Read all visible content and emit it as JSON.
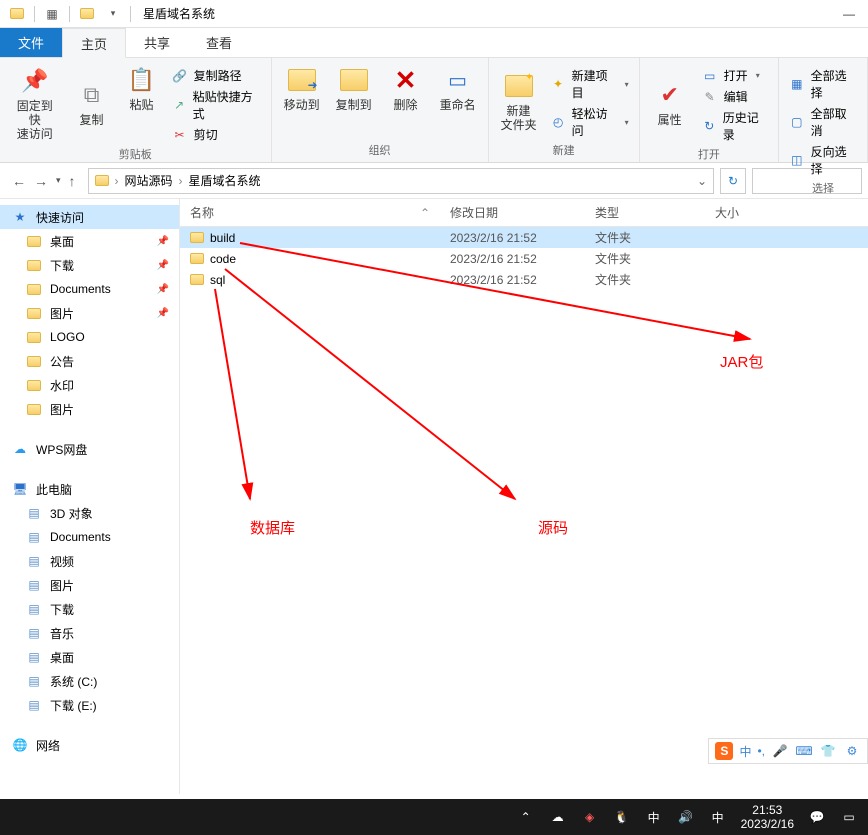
{
  "window": {
    "title": "星盾域名系统"
  },
  "tabs": {
    "file": "文件",
    "home": "主页",
    "share": "共享",
    "view": "查看"
  },
  "ribbon": {
    "clipboard": {
      "pin": "固定到快\n速访问",
      "copy": "复制",
      "paste": "粘贴",
      "copy_path": "复制路径",
      "paste_shortcut": "粘贴快捷方式",
      "cut": "剪切",
      "label": "剪贴板"
    },
    "organize": {
      "moveto": "移动到",
      "copyto": "复制到",
      "delete": "删除",
      "rename": "重命名",
      "label": "组织"
    },
    "new": {
      "newfolder": "新建\n文件夹",
      "newitem": "新建项目",
      "easyaccess": "轻松访问",
      "label": "新建"
    },
    "open": {
      "properties": "属性",
      "open": "打开",
      "edit": "编辑",
      "history": "历史记录",
      "label": "打开"
    },
    "select": {
      "all": "全部选择",
      "none": "全部取消",
      "invert": "反向选择",
      "label": "选择"
    }
  },
  "breadcrumb": {
    "root": "网站源码",
    "current": "星盾域名系统"
  },
  "columns": {
    "name": "名称",
    "date": "修改日期",
    "type": "类型",
    "size": "大小"
  },
  "rows": [
    {
      "name": "build",
      "date": "2023/2/16 21:52",
      "type": "文件夹",
      "selected": true
    },
    {
      "name": "code",
      "date": "2023/2/16 21:52",
      "type": "文件夹",
      "selected": false
    },
    {
      "name": "sql",
      "date": "2023/2/16 21:52",
      "type": "文件夹",
      "selected": false
    }
  ],
  "sidebar": {
    "quick": {
      "label": "快速访问",
      "items": [
        {
          "label": "桌面",
          "pin": true
        },
        {
          "label": "下载",
          "pin": true
        },
        {
          "label": "Documents",
          "pin": true
        },
        {
          "label": "图片",
          "pin": true
        },
        {
          "label": "LOGO",
          "pin": false
        },
        {
          "label": "公告",
          "pin": false
        },
        {
          "label": "水印",
          "pin": false
        },
        {
          "label": "图片",
          "pin": false
        }
      ]
    },
    "wps": {
      "label": "WPS网盘"
    },
    "thispc": {
      "label": "此电脑",
      "items": [
        {
          "label": "3D 对象"
        },
        {
          "label": "Documents"
        },
        {
          "label": "视频"
        },
        {
          "label": "图片"
        },
        {
          "label": "下载"
        },
        {
          "label": "音乐"
        },
        {
          "label": "桌面"
        },
        {
          "label": "系统 (C:)"
        },
        {
          "label": "下载 (E:)"
        }
      ]
    },
    "network": {
      "label": "网络"
    }
  },
  "annotations": {
    "jar": "JAR包",
    "db": "数据库",
    "src": "源码"
  },
  "ime": {
    "zhong": "中"
  },
  "taskbar": {
    "time": "21:53",
    "date": "2023/2/16"
  }
}
